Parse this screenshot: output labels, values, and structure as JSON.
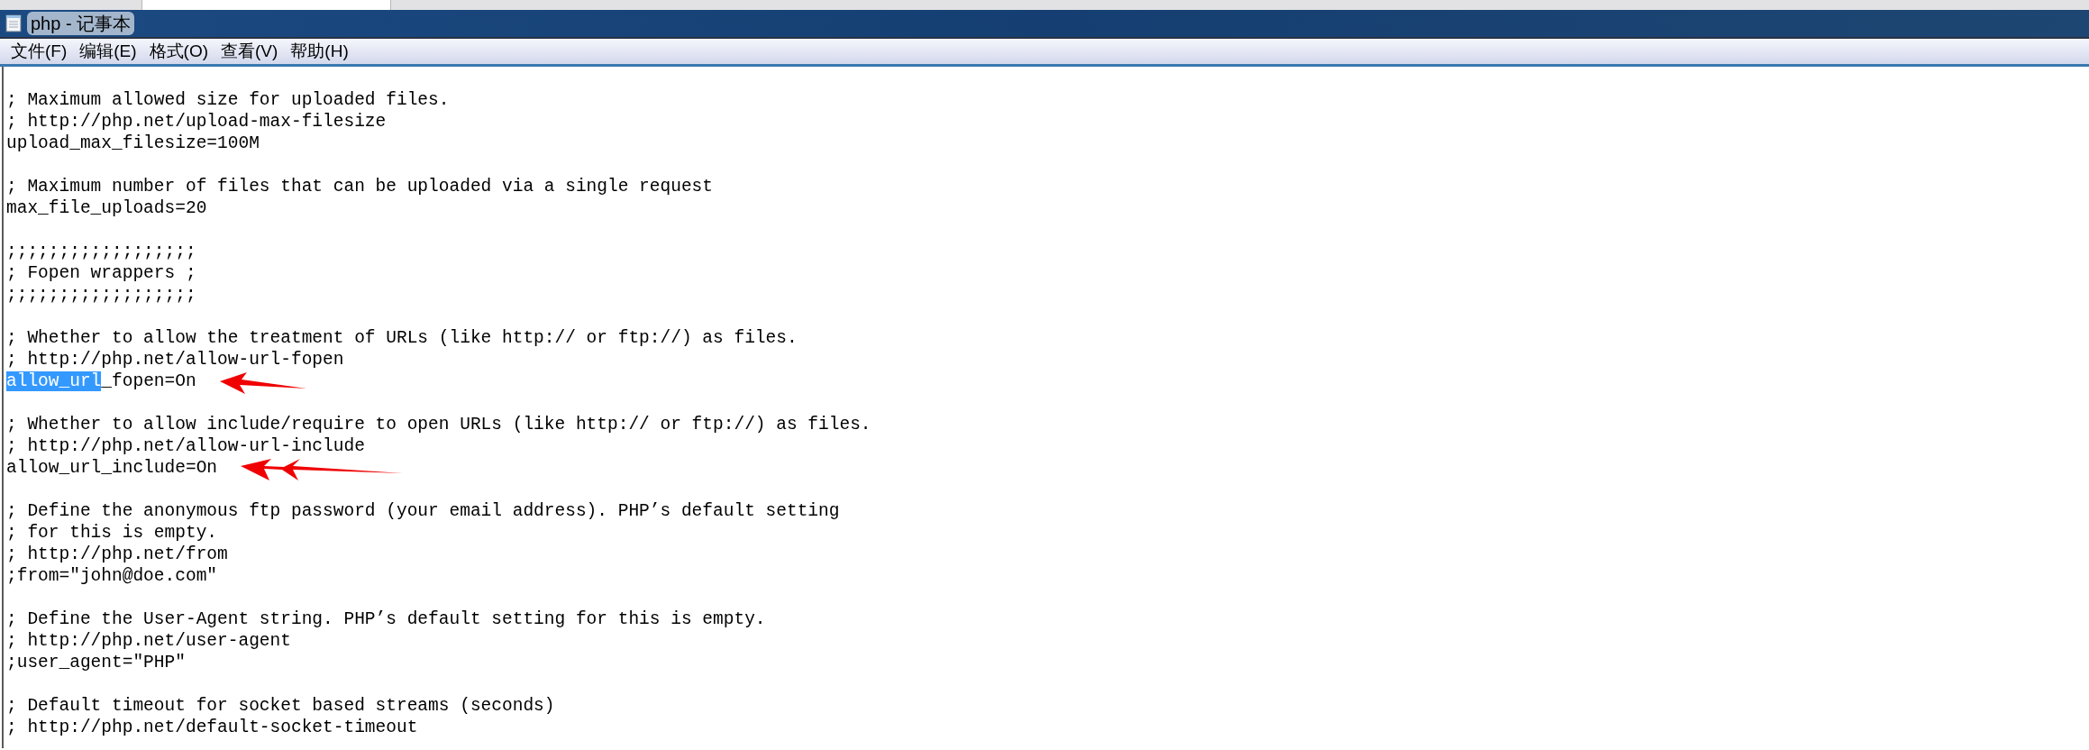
{
  "window": {
    "title": "php - 记事本"
  },
  "menu": [
    "文件(F)",
    "编辑(E)",
    "格式(O)",
    "查看(V)",
    "帮助(H)"
  ],
  "lines": [
    {
      "kind": "blank"
    },
    {
      "kind": "text",
      "text": "; Maximum allowed size for uploaded files."
    },
    {
      "kind": "text",
      "text": "; http://php.net/upload-max-filesize"
    },
    {
      "kind": "text",
      "text": "upload_max_filesize=100M"
    },
    {
      "kind": "blank"
    },
    {
      "kind": "text",
      "text": "; Maximum number of files that can be uploaded via a single request"
    },
    {
      "kind": "text",
      "text": "max_file_uploads=20"
    },
    {
      "kind": "blank"
    },
    {
      "kind": "text",
      "text": ";;;;;;;;;;;;;;;;;;"
    },
    {
      "kind": "text",
      "text": "; Fopen wrappers ;"
    },
    {
      "kind": "text",
      "text": ";;;;;;;;;;;;;;;;;;"
    },
    {
      "kind": "blank"
    },
    {
      "kind": "text",
      "text": "; Whether to allow the treatment of URLs (like http:// or ftp://) as files."
    },
    {
      "kind": "text",
      "text": "; http://php.net/allow-url-fopen"
    },
    {
      "kind": "text",
      "selected_text": "allow_url",
      "text": "_fopen=On",
      "arrow": true,
      "double_arrow": false
    },
    {
      "kind": "blank"
    },
    {
      "kind": "text",
      "text": "; Whether to allow include/require to open URLs (like http:// or ftp://) as files."
    },
    {
      "kind": "text",
      "text": "; http://php.net/allow-url-include"
    },
    {
      "kind": "text",
      "text": "allow_url_include=On",
      "arrow": true,
      "double_arrow": true
    },
    {
      "kind": "blank"
    },
    {
      "kind": "text",
      "text": "; Define the anonymous ftp password (your email address). PHP’s default setting"
    },
    {
      "kind": "text",
      "text": "; for this is empty."
    },
    {
      "kind": "text",
      "text": "; http://php.net/from"
    },
    {
      "kind": "text",
      "text": ";from=\"john@doe.com\""
    },
    {
      "kind": "blank"
    },
    {
      "kind": "text",
      "text": "; Define the User-Agent string. PHP’s default setting for this is empty."
    },
    {
      "kind": "text",
      "text": "; http://php.net/user-agent"
    },
    {
      "kind": "text",
      "text": ";user_agent=\"PHP\""
    },
    {
      "kind": "blank"
    },
    {
      "kind": "text",
      "text": "; Default timeout for socket based streams (seconds)"
    },
    {
      "kind": "text",
      "text": "; http://php.net/default-socket-timeout"
    }
  ]
}
